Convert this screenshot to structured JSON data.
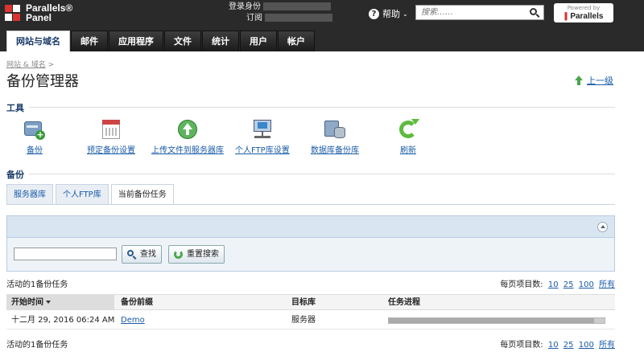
{
  "header": {
    "logo_line1": "Parallels®",
    "logo_line2": "Panel",
    "login_label": "登录身份",
    "subscription_label": "订阅",
    "help_label": "帮助",
    "search_placeholder": "搜索……",
    "powered_by": "Powered by",
    "powered_brand": "Parallels",
    "tabs": [
      {
        "label": "网站与域名",
        "active": true
      },
      {
        "label": "邮件"
      },
      {
        "label": "应用程序"
      },
      {
        "label": "文件"
      },
      {
        "label": "统计"
      },
      {
        "label": "用户"
      },
      {
        "label": "帐户"
      }
    ]
  },
  "breadcrumb": {
    "item": "网站 & 域名",
    "separator": ">"
  },
  "page_title": "备份管理器",
  "up_level": "上一级",
  "tools_section": {
    "label": "工具",
    "items": [
      {
        "label": "备份",
        "icon": "backup-icon"
      },
      {
        "label": "预定备份设置",
        "icon": "schedule-icon"
      },
      {
        "label": "上传文件到服务器库",
        "icon": "upload-icon"
      },
      {
        "label": "个人FTP库设置",
        "icon": "ftp-settings-icon"
      },
      {
        "label": "数据库备份库",
        "icon": "database-icon"
      },
      {
        "label": "刷新",
        "icon": "refresh-icon"
      }
    ]
  },
  "backup_section": {
    "label": "备份",
    "tabs": [
      {
        "label": "服务器库"
      },
      {
        "label": "个人FTP库"
      },
      {
        "label": "当前备份任务",
        "active": true
      }
    ]
  },
  "filter": {
    "search_value": "",
    "search_button": "查找",
    "reset_button": "重置搜索"
  },
  "list": {
    "count_top": "活动的1备份任务",
    "count_bottom": "活动的1备份任务",
    "per_page_label": "每页项目数:",
    "per_page_options": [
      "10",
      "25",
      "100",
      "所有"
    ],
    "columns": [
      "开始时间",
      "备份前缀",
      "目标库",
      "任务进程"
    ],
    "rows": [
      {
        "start": "十二月 29, 2016 06:24 AM",
        "prefix": "Demo",
        "target": "服务器",
        "progress": 0.95
      }
    ]
  },
  "colors": {
    "header_bg": "#2a2a2a",
    "link": "#1a5ba8",
    "heading": "#1a3a6a",
    "panel_bg": "#d9e6f2"
  }
}
